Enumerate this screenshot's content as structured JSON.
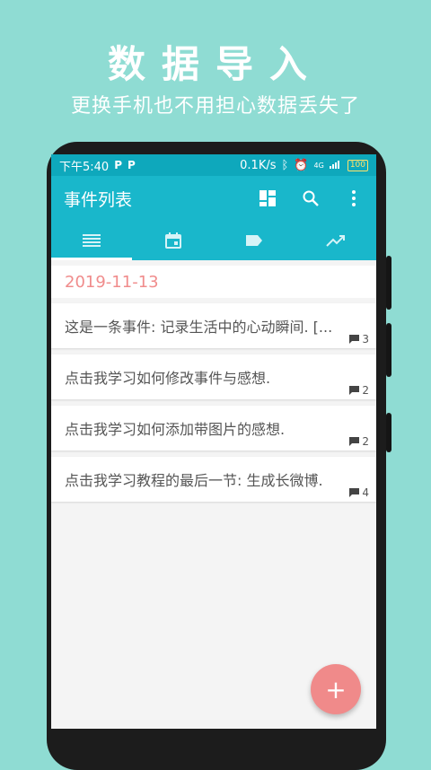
{
  "promo": {
    "title": "数据导入",
    "subtitle": "更换手机也不用担心数据丢失了"
  },
  "statusbar": {
    "time": "下午5:40",
    "notif_icons": [
      "P",
      "P"
    ],
    "network_speed": "0.1K/s",
    "signal": "4G",
    "battery": "100"
  },
  "appbar": {
    "title": "事件列表",
    "icons": [
      "dashboard-icon",
      "search-icon",
      "more-vert-icon"
    ]
  },
  "tabs": [
    {
      "icon": "list-icon",
      "selected": true
    },
    {
      "icon": "calendar-icon",
      "selected": false
    },
    {
      "icon": "label-icon",
      "selected": false
    },
    {
      "icon": "trending-up-icon",
      "selected": false
    }
  ],
  "events": {
    "date": "2019-11-13",
    "items": [
      {
        "text": "这是一条事件: 记录生活中的心动瞬间. [...",
        "comments": "3"
      },
      {
        "text": "点击我学习如何修改事件与感想.",
        "comments": "2"
      },
      {
        "text": "点击我学习如何添加带图片的感想.",
        "comments": "2"
      },
      {
        "text": "点击我学习教程的最后一节: 生成长微博.",
        "comments": "4"
      }
    ]
  },
  "fab": {
    "label": "+"
  },
  "colors": {
    "background": "#8fdcd3",
    "primary": "#19b7cb",
    "accent": "#f08a8a"
  }
}
